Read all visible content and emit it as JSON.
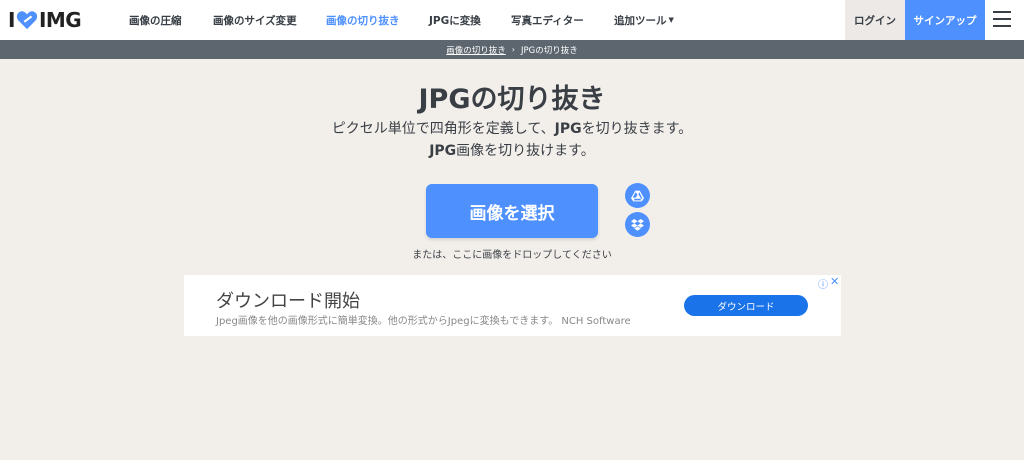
{
  "header": {
    "logo_left": "I",
    "logo_right": "IMG",
    "nav": [
      {
        "label": "画像の圧縮"
      },
      {
        "label": "画像のサイズ変更"
      },
      {
        "label": "画像の切り抜き"
      },
      {
        "label": "JPGに変換"
      },
      {
        "label": "写真エディター"
      },
      {
        "label": "追加ツール"
      }
    ],
    "more_caret": "▼",
    "login": "ログイン",
    "signup": "サインアップ"
  },
  "breadcrumb": {
    "parent": "画像の切り抜き",
    "separator": "›",
    "current": "JPGの切り抜き"
  },
  "hero": {
    "title": "JPGの切り抜き",
    "sub1_before": "ピクセル単位で四角形を定義して、",
    "sub1_bold": "JPG",
    "sub1_after": "を切り抜きます。",
    "sub2_bold": "JPG",
    "sub2_after": "画像を切り抜けます。",
    "select_button": "画像を選択",
    "drop_hint": "または、ここに画像をドロップしてください"
  },
  "ad": {
    "title": "ダウンロード開始",
    "description": "Jpeg画像を他の画像形式に簡単変換。他の形式からJpegに変換もできます。 NCH Software",
    "button": "ダウンロード",
    "info_icon": "ⓘ",
    "close_icon": "✕"
  },
  "colors": {
    "accent": "#4d90fe",
    "background": "#f2efeb",
    "breadcrumb_bar": "#5d666f"
  },
  "icons": {
    "logo_heart": "heart-icon",
    "cloud1": "google-drive-icon",
    "cloud2": "dropbox-icon",
    "menu": "hamburger-menu-icon"
  }
}
